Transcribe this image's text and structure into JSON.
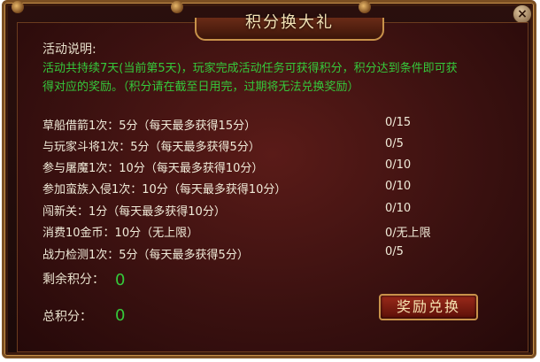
{
  "title": "积分换大礼",
  "description": {
    "heading": "活动说明:",
    "lines": [
      "活动共持续7天(当前第5天)，玩家完成活动任务可获得积分，积分达到条件即可获",
      "得对应的奖励。（积分请在截至日用完，过期将无法兑换奖励）"
    ]
  },
  "tasks": [
    {
      "label": "草船借箭1次：5分（每天最多获得15分）",
      "progress": "0/15"
    },
    {
      "label": "与玩家斗将1次：5分（每天最多获得5分）",
      "progress": "0/5"
    },
    {
      "label": "参与屠魔1次：10分（每天最多获得10分）",
      "progress": "0/10"
    },
    {
      "label": "参加蛮族入侵1次：10分（每天最多获得10分）",
      "progress": "0/10"
    },
    {
      "label": "闯新关：1分（每天最多获得10分）",
      "progress": "0/10"
    },
    {
      "label": "消费10金币：10分（无上限）",
      "progress": "0/无上限"
    },
    {
      "label": "战力检测1次：5分（每天最多获得5分）",
      "progress": "0/5"
    }
  ],
  "scores": {
    "remaining_label": "剩余积分：",
    "remaining_value": "0",
    "total_label": "总积分：",
    "total_value": "0"
  },
  "redeem_button": "奖励兑换"
}
